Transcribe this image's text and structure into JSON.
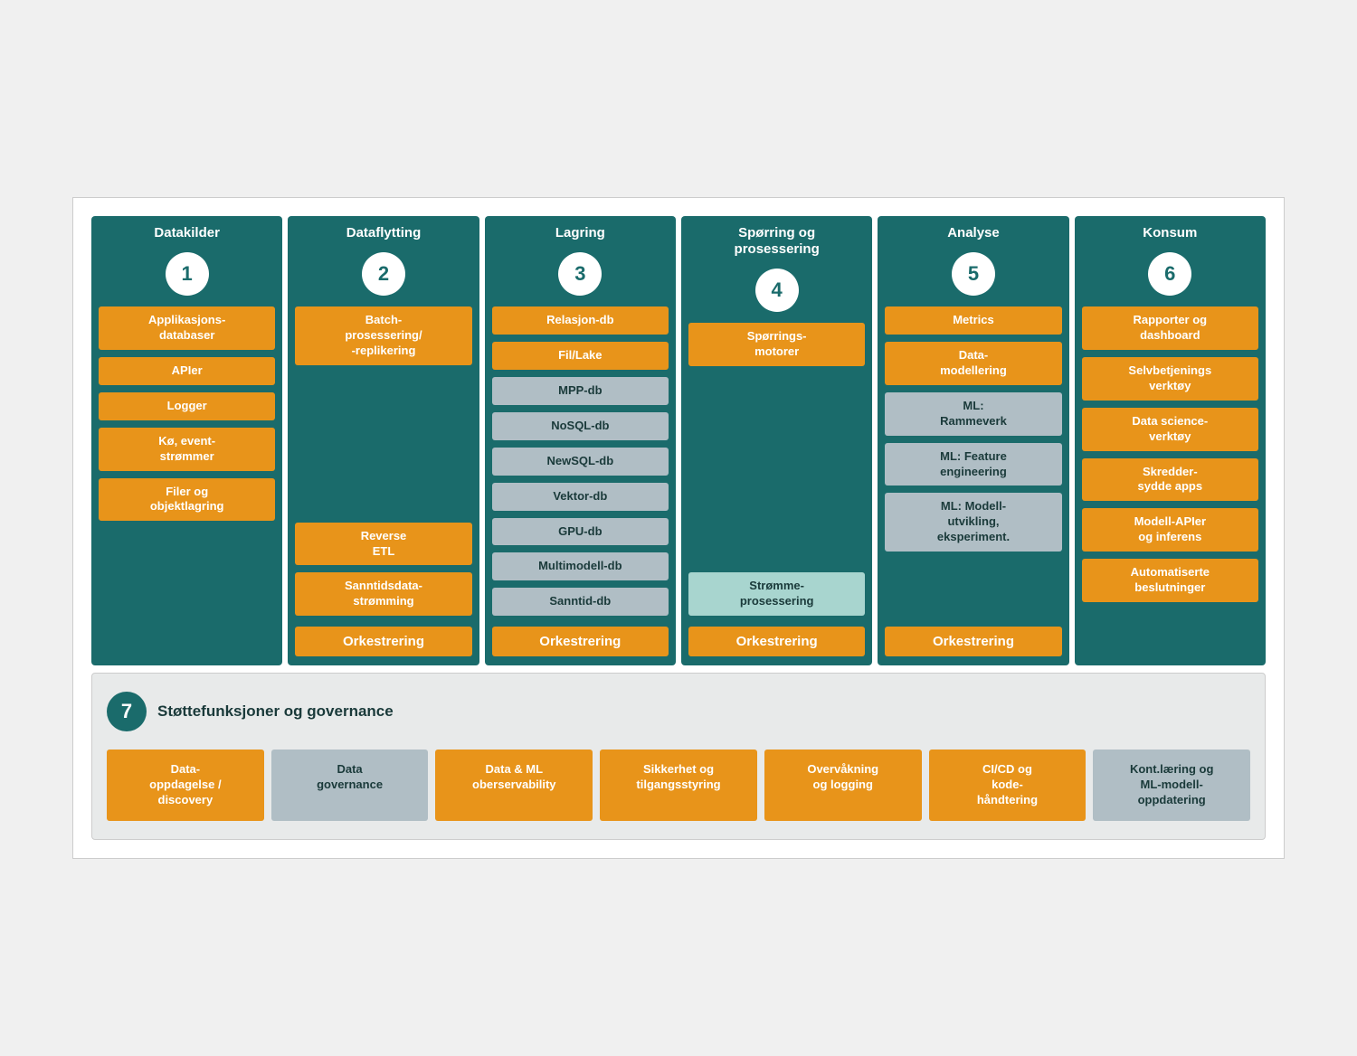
{
  "columns": [
    {
      "id": "col1",
      "header": "Datakilder",
      "number": "1",
      "cards": [
        {
          "label": "Applikasjons-\ndatabaser",
          "type": "orange"
        },
        {
          "label": "APIer",
          "type": "orange"
        },
        {
          "label": "Logger",
          "type": "orange"
        },
        {
          "label": "Kø, event-\nstrømmer",
          "type": "orange"
        },
        {
          "label": "Filer og\nobjektlagring",
          "type": "orange"
        }
      ],
      "orkestrering": false
    },
    {
      "id": "col2",
      "header": "Dataflytting",
      "number": "2",
      "cards_top": [
        {
          "label": "Batch-\nprosessering/\n-replikering",
          "type": "orange"
        }
      ],
      "cards_bottom": [
        {
          "label": "Reverse\nETL",
          "type": "orange"
        },
        {
          "label": "Sanntidsdata-\nstrømming",
          "type": "orange"
        }
      ],
      "orkestrering": true
    },
    {
      "id": "col3",
      "header": "Lagring",
      "number": "3",
      "cards": [
        {
          "label": "Relasjon-db",
          "type": "orange"
        },
        {
          "label": "Fil/Lake",
          "type": "orange"
        },
        {
          "label": "MPP-db",
          "type": "gray"
        },
        {
          "label": "NoSQL-db",
          "type": "gray"
        },
        {
          "label": "NewSQL-db",
          "type": "gray"
        },
        {
          "label": "Vektor-db",
          "type": "gray"
        },
        {
          "label": "GPU-db",
          "type": "gray"
        },
        {
          "label": "Multimodell-db",
          "type": "gray"
        },
        {
          "label": "Sanntid-db",
          "type": "gray"
        }
      ],
      "orkestrering": true
    },
    {
      "id": "col4",
      "header": "Spørring og\nprosessering",
      "number": "4",
      "cards_top": [
        {
          "label": "Spørrings-\nmotorer",
          "type": "orange"
        }
      ],
      "cards_bottom": [
        {
          "label": "Strømme-\nprosessering",
          "type": "teal"
        }
      ],
      "orkestrering": true
    },
    {
      "id": "col5",
      "header": "Analyse",
      "number": "5",
      "cards": [
        {
          "label": "Metrics",
          "type": "orange"
        },
        {
          "label": "Data-\nmodellering",
          "type": "orange"
        },
        {
          "label": "ML:\nRammeverk",
          "type": "gray"
        },
        {
          "label": "ML: Feature\nengineering",
          "type": "gray"
        },
        {
          "label": "ML: Modell-\nutvikling,\nexperiment.",
          "type": "gray"
        }
      ],
      "orkestrering": true
    },
    {
      "id": "col6",
      "header": "Konsum",
      "number": "6",
      "cards": [
        {
          "label": "Rapporter og\ndashboard",
          "type": "orange"
        },
        {
          "label": "Selvbetjenings\nverktøy",
          "type": "orange"
        },
        {
          "label": "Data science-\nverktøy",
          "type": "orange"
        },
        {
          "label": "Skredder-\nsydde apps",
          "type": "orange"
        },
        {
          "label": "Modell-APIer\nog inferens",
          "type": "orange"
        },
        {
          "label": "Automatiserte\nbeslutninger",
          "type": "orange"
        }
      ],
      "orkestrering": false
    }
  ],
  "orkestrering_label": "Orkestrering",
  "bottom": {
    "badge": "7",
    "title": "Støttefunksjoner og governance",
    "cards": [
      {
        "label": "Data-\noppdagelse /\ndiscovery",
        "type": "orange"
      },
      {
        "label": "Data\ngovernance",
        "type": "gray"
      },
      {
        "label": "Data & ML\noberservability",
        "type": "orange"
      },
      {
        "label": "Sikkerhet og\ntilgangsstyring",
        "type": "orange"
      },
      {
        "label": "Overvåkning\nog logging",
        "type": "orange"
      },
      {
        "label": "CI/CD og\nkode-\nhåndtering",
        "type": "orange"
      },
      {
        "label": "Kont.læring og\nML-modell-\noppdatering",
        "type": "gray"
      }
    ]
  }
}
